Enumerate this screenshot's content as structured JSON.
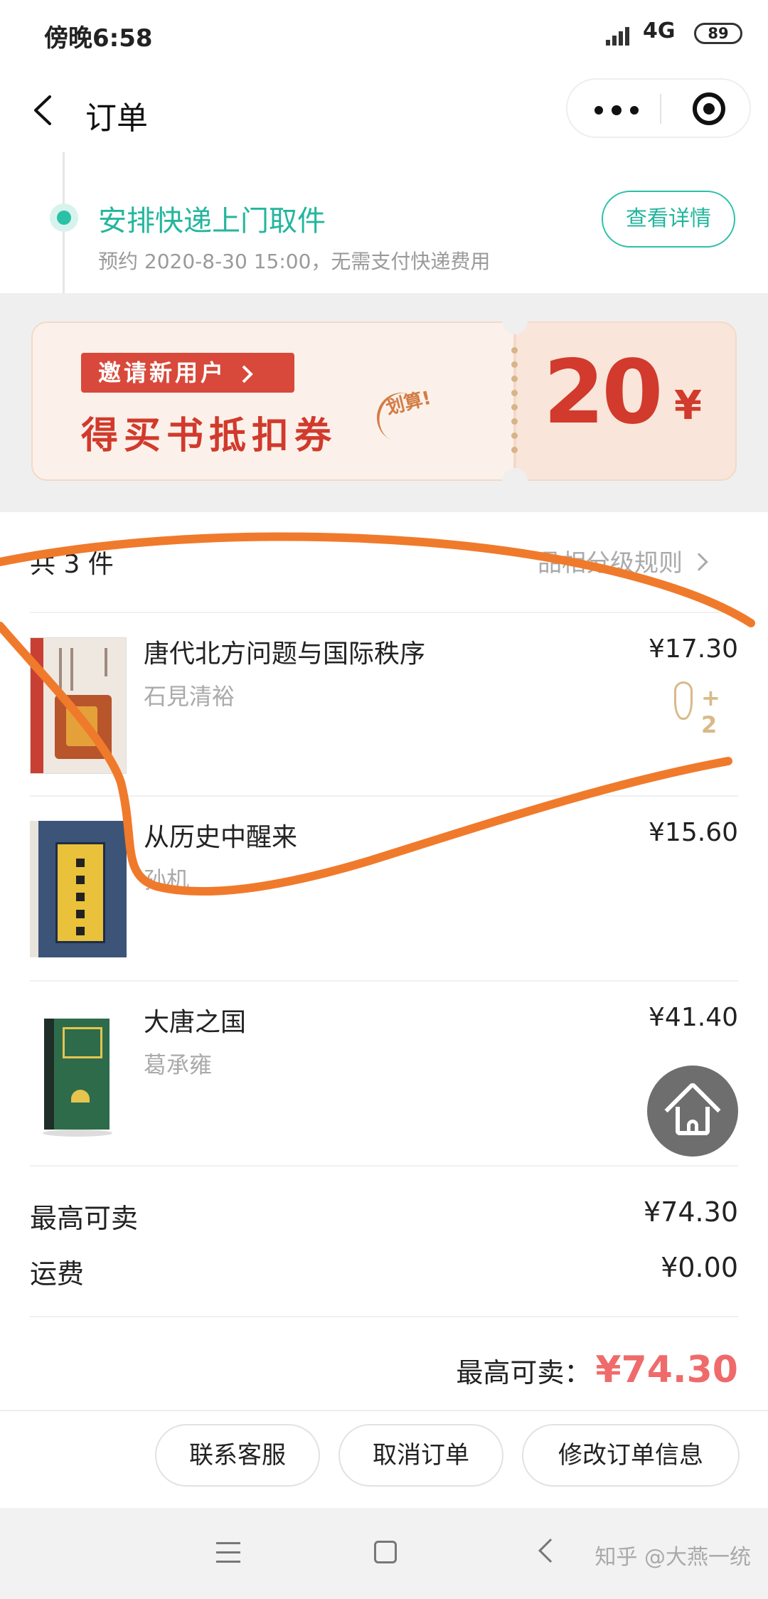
{
  "status_bar": {
    "time": "傍晚6:58",
    "network": "4G",
    "battery": "89"
  },
  "nav": {
    "title": "订单"
  },
  "shipping": {
    "title": "安排快递上门取件",
    "subtitle": "预约 2020-8-30 15:00，无需支付快递费用",
    "detail_button": "查看详情"
  },
  "banner": {
    "invite_label": "邀请新用户",
    "headline": "得买书抵扣券",
    "stamp": "划算!",
    "amount": "20",
    "currency": "¥",
    "colors": {
      "primary": "#d13a2c",
      "background": "#fbf1ea"
    }
  },
  "items_header": {
    "count": "共 3 件",
    "rule_link": "品相分级规则"
  },
  "items": [
    {
      "name": "唐代北方问题与国际秩序",
      "author": "石見清裕",
      "price": "¥17.30",
      "bonus": "+ 2"
    },
    {
      "name": "从历史中醒来",
      "author": "孙机",
      "price": "¥15.60"
    },
    {
      "name": "大唐之国",
      "author": "葛承雍",
      "price": "¥41.40"
    }
  ],
  "summary": {
    "max_sell_label": "最高可卖",
    "max_sell_value": "¥74.30",
    "shipping_label": "运费",
    "shipping_value": "¥0.00",
    "total_label": "最高可卖：",
    "total_value": "¥74.30"
  },
  "actions": {
    "contact": "联系客服",
    "cancel": "取消订单",
    "edit": "修改订单信息"
  },
  "watermark": "知乎 @大燕一统",
  "colors": {
    "accent_teal": "#2bc1a7",
    "total_red": "#ef6b6b",
    "marker_orange": "#f07a2b"
  }
}
